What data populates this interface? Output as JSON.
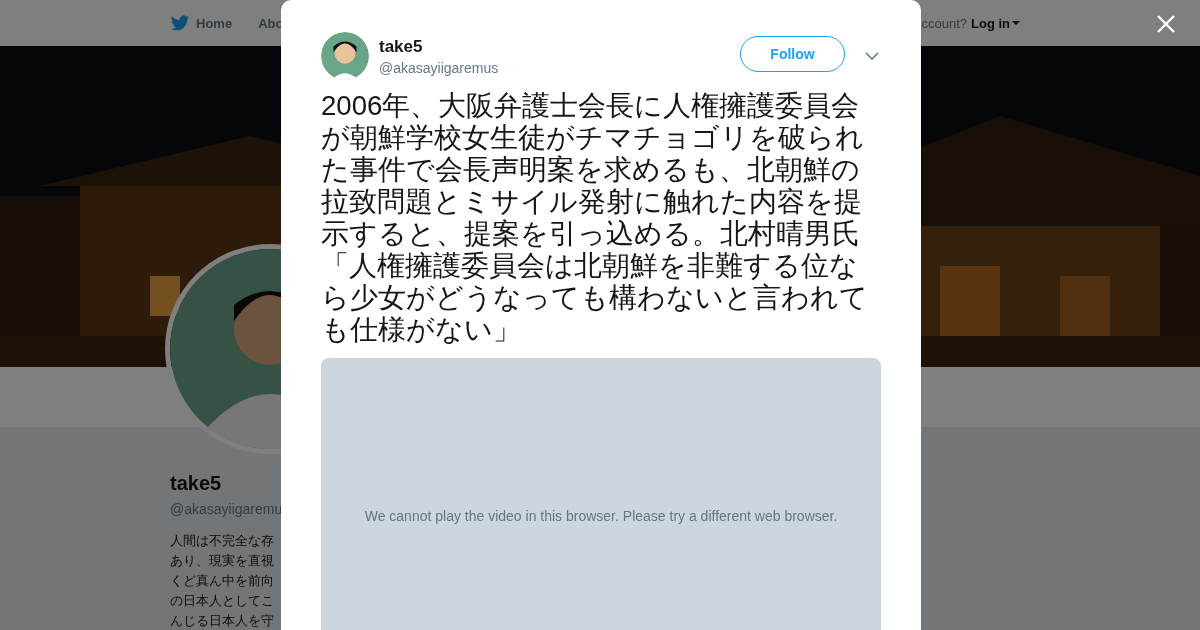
{
  "background_page": {
    "nav": [
      {
        "kind": "logo",
        "label": "Home"
      },
      {
        "kind": "text",
        "label": "Abo"
      }
    ],
    "account_prompt": "ccount?",
    "login": "Log in",
    "profile": {
      "name": "take5",
      "handle": "@akasayiigaremu",
      "bio_lines": [
        "人間は不完全な存",
        "あり、現実を直視",
        "くど真ん中を前向",
        "の日本人としてこ",
        "んじる日本人を守"
      ]
    }
  },
  "modal": {
    "author": {
      "name": "take5",
      "handle": "@akasayiigaremus"
    },
    "follow_button": "Follow",
    "tweet_text": "2006年、大阪弁護士会長に人権擁護委員会が朝鮮学校女生徒がチマチョゴリを破られた事件で会長声明案を求めるも、北朝鮮の拉致問題とミサイル発射に触れた内容を提示すると、提案を引っ込める。北村晴男氏「人権擁護委員会は北朝鮮を非難する位なら少女がどうなっても構わないと言われても仕様がない」",
    "video": {
      "message": "We cannot play the video in this browser. Please try a different web browser."
    }
  }
}
